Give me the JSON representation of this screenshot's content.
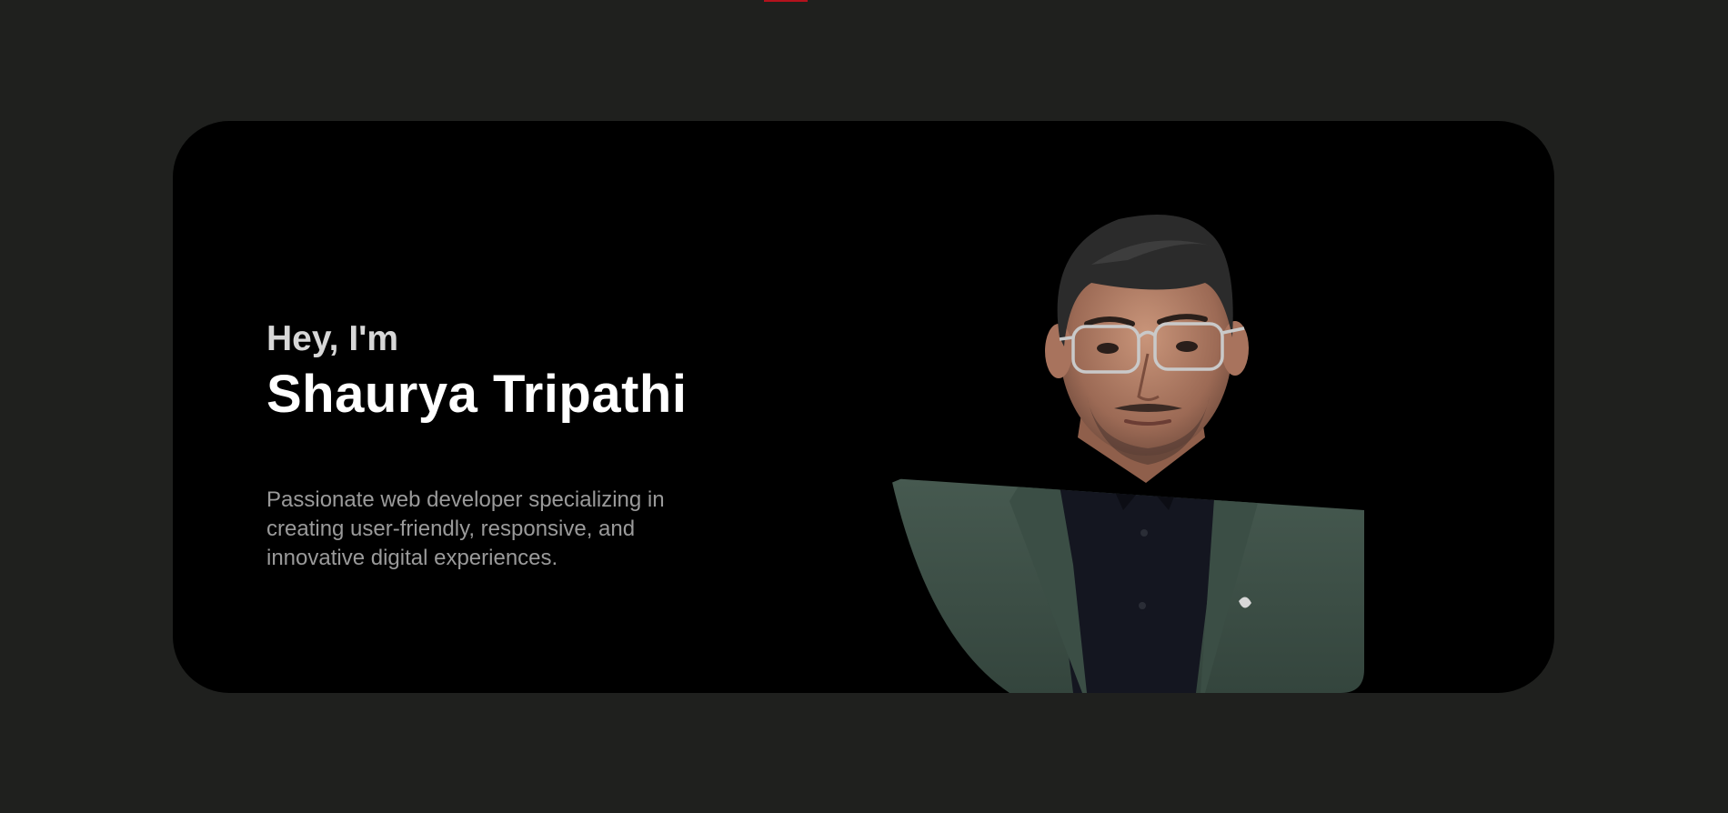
{
  "hero": {
    "greeting": "Hey, I'm",
    "name": "Shaurya Tripathi",
    "bio": "Passionate web developer specializing in creating user-friendly, responsive, and innovative digital experiences."
  },
  "colors": {
    "page_background": "#1f201e",
    "card_background": "#000000",
    "accent": "#b3121d"
  }
}
